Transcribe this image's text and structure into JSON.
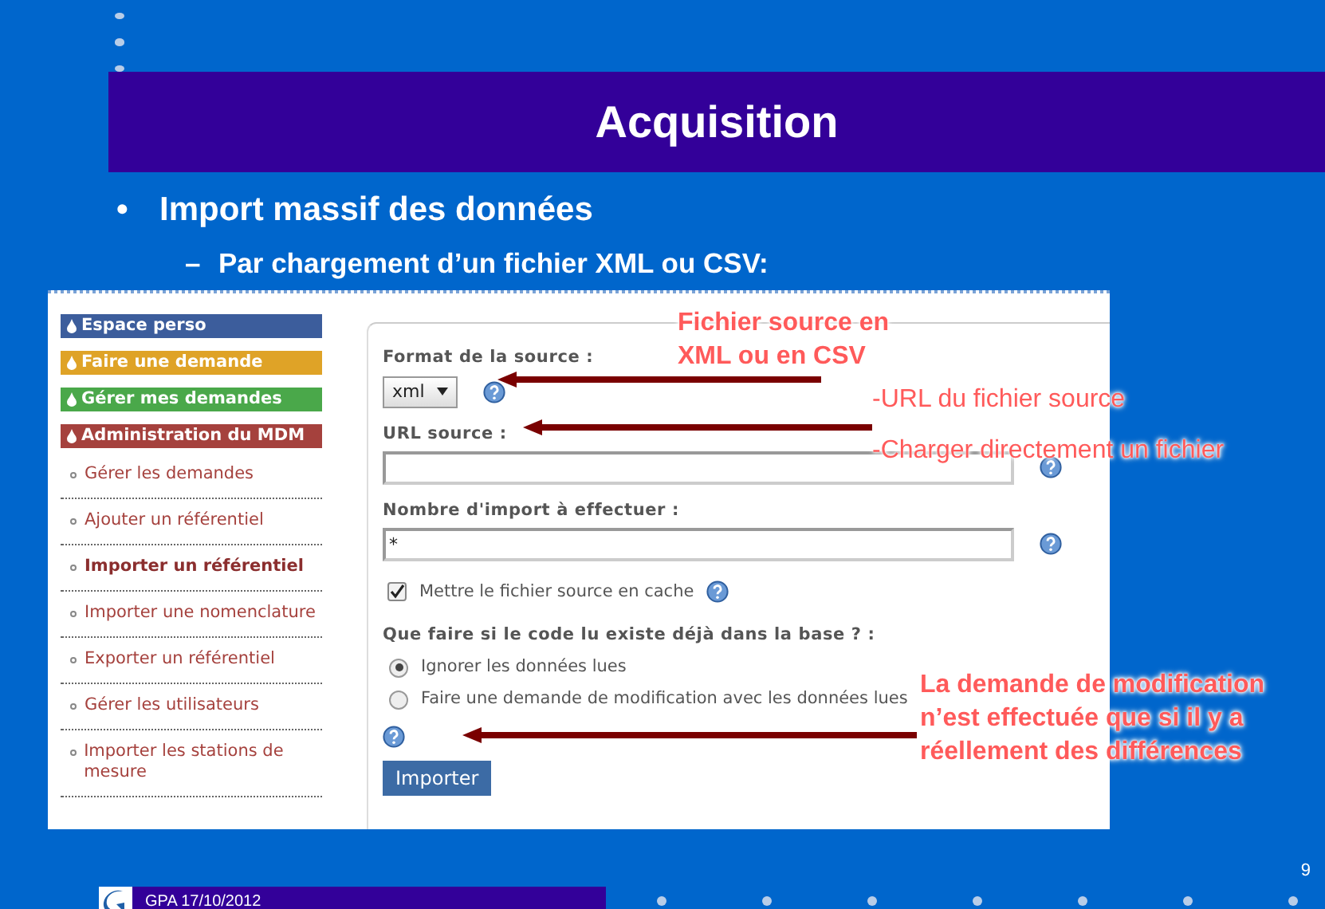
{
  "slide": {
    "title": "Acquisition",
    "bullets": [
      {
        "marker": "•",
        "text": "Import massif des données",
        "children": [
          {
            "marker": "–",
            "text": "Par chargement d’un fichier XML ou CSV:"
          }
        ]
      }
    ]
  },
  "screenshot": {
    "menu": [
      {
        "label": "Espace perso",
        "color": "#3c5d9c"
      },
      {
        "label": "Faire une demande",
        "color": "#dfa327"
      },
      {
        "label": "Gérer mes demandes",
        "color": "#4aa84a"
      },
      {
        "label": "Administration du MDM",
        "color": "#a5413d"
      }
    ],
    "submenu": [
      {
        "label": "Gérer les demandes",
        "selected": false
      },
      {
        "label": "Ajouter un référentiel",
        "selected": false
      },
      {
        "label": "Importer un référentiel",
        "selected": true
      },
      {
        "label": "Importer une nomenclature",
        "selected": false
      },
      {
        "label": "Exporter un référentiel",
        "selected": false
      },
      {
        "label": "Gérer les utilisateurs",
        "selected": false
      },
      {
        "label": "Importer les stations de mesure",
        "selected": false
      }
    ],
    "form": {
      "format_label": "Format de la source :",
      "format_value": "xml",
      "url_label": "URL source :",
      "count_label": "Nombre d'import à effectuer :",
      "count_value": "*",
      "cache": {
        "label": "Mettre le fichier source en cache",
        "checked": true
      },
      "question": "Que faire si le code lu existe déjà dans la base ? :",
      "options": [
        {
          "label": "Ignorer les données lues",
          "selected": true
        },
        {
          "label": "Faire une demande de modification avec les données lues",
          "selected": false
        }
      ],
      "button": "Importer"
    }
  },
  "annotations": [
    {
      "lines": [
        "Fichier source en",
        "XML ou en CSV"
      ],
      "bold": true
    },
    {
      "lines": [
        "-URL du fichier source"
      ],
      "bold": false
    },
    {
      "lines": [
        "-Charger directement un fichier"
      ],
      "bold": false
    },
    {
      "lines": [
        "La demande de modification",
        "n’est effectuée  que si il y a",
        "réellement des différences"
      ],
      "bold": true
    }
  ],
  "footer": {
    "caption": "GPA 17/10/2012",
    "page": "9"
  }
}
